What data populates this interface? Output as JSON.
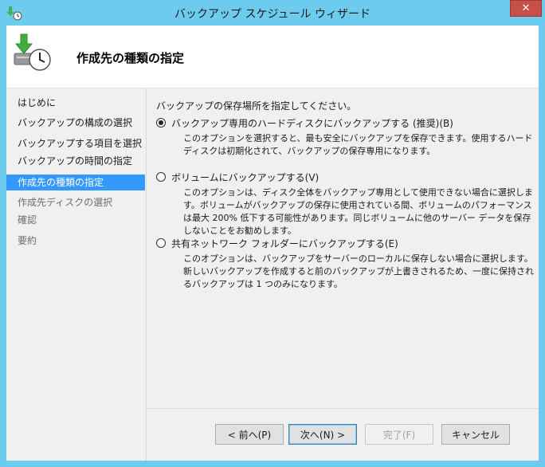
{
  "window": {
    "title": "バックアップ スケジュール ウィザード",
    "close_label": "✕"
  },
  "header": {
    "title": "作成先の種類の指定"
  },
  "sidebar": {
    "items": [
      {
        "label": "はじめに",
        "state": "normal"
      },
      {
        "label": "バックアップの構成の選択",
        "state": "normal"
      },
      {
        "label": "バックアップする項目を選択",
        "state": "normal"
      },
      {
        "label": "バックアップの時間の指定",
        "state": "normal"
      },
      {
        "label": "作成先の種類の指定",
        "state": "active"
      },
      {
        "label": "作成先ディスクの選択",
        "state": "disabled"
      },
      {
        "label": "確認",
        "state": "disabled"
      },
      {
        "label": "要約",
        "state": "disabled"
      }
    ]
  },
  "main": {
    "prompt": "バックアップの保存場所を指定してください。",
    "options": [
      {
        "label": "バックアップ専用のハードディスクにバックアップする (推奨)(B)",
        "checked": true,
        "desc": "このオプションを選択すると、最も安全にバックアップを保存できます。使用するハードディスクは初期化されて、バックアップの保存専用になります。"
      },
      {
        "label": "ボリュームにバックアップする(V)",
        "checked": false,
        "desc": "このオプションは、ディスク全体をバックアップ専用として使用できない場合に選択します。ボリュームがバックアップの保存に使用されている間、ボリュームのパフォーマンスは最大 200% 低下する可能性があります。同じボリュームに他のサーバー データを保存しないことをお勧めします。"
      },
      {
        "label": "共有ネットワーク フォルダーにバックアップする(E)",
        "checked": false,
        "desc": "このオプションは、バックアップをサーバーのローカルに保存しない場合に選択します。新しいバックアップを作成すると前のバックアップが上書きされるため、一度に保持されるバックアップは 1 つのみになります。"
      }
    ]
  },
  "footer": {
    "back_label": "< 前へ(P)",
    "next_label": "次へ(N) >",
    "finish_label": "完了(F)",
    "cancel_label": "キャンセル"
  },
  "colors": {
    "frame": "#6ccbee",
    "selection": "#3399ff",
    "close": "#c7504a"
  },
  "icons": {
    "app": "backup-app-icon",
    "header": "backup-clock-icon",
    "close": "close-icon"
  }
}
